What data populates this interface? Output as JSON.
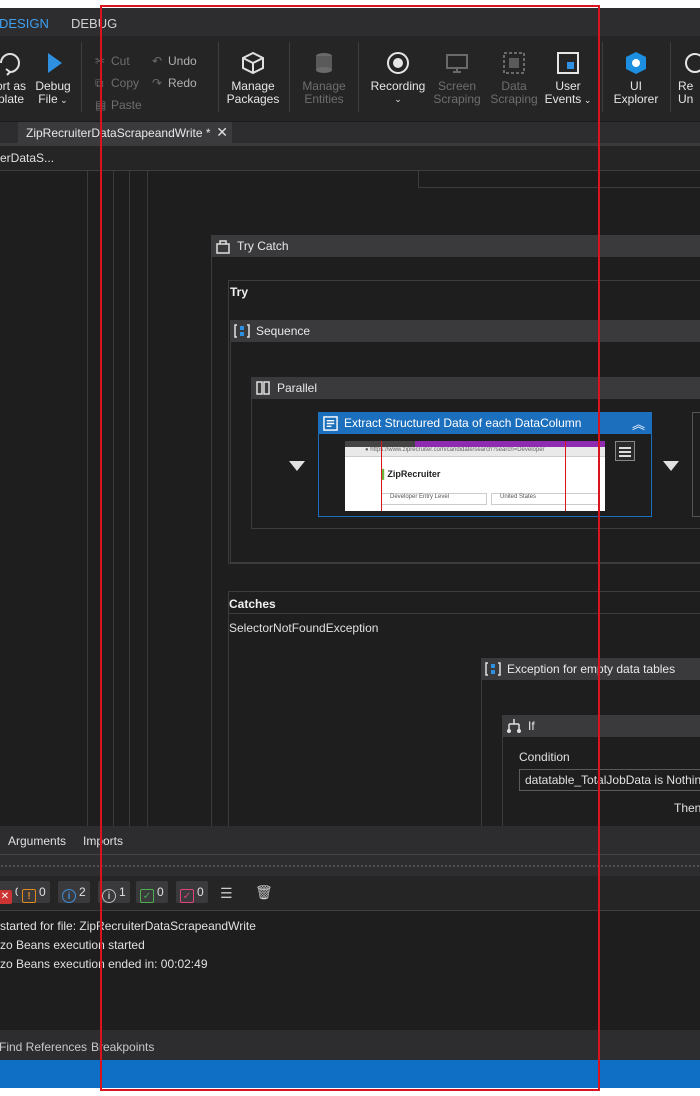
{
  "tabs": {
    "design": "DESIGN",
    "debug": "DEBUG"
  },
  "ribbon": {
    "export_template": [
      "ort as",
      "plate"
    ],
    "debug_file": [
      "Debug",
      "File"
    ],
    "cut": "Cut",
    "copy": "Copy",
    "paste": "Paste",
    "undo": "Undo",
    "redo": "Redo",
    "manage_packages": [
      "Manage",
      "Packages"
    ],
    "manage_entities": [
      "Manage",
      "Entities"
    ],
    "recording": "Recording",
    "screen_scraping": [
      "Screen",
      "Scraping"
    ],
    "data_scraping": [
      "Data",
      "Scraping"
    ],
    "user_events": [
      "User",
      "Events"
    ],
    "ui_explorer": [
      "UI",
      "Explorer"
    ],
    "remove_unused": [
      "Re",
      "Un"
    ]
  },
  "document": {
    "tab_title": "ZipRecruiterDataScrapeandWrite *",
    "breadcrumb": "erDataS..."
  },
  "workflow": {
    "try_catch": "Try Catch",
    "try_label": "Try",
    "sequence": "Sequence",
    "parallel": "Parallel",
    "extract_activity": "Extract Structured Data of each DataColumn",
    "thumb_site": "ZipRecruiter",
    "thumb_search": "Developer Entry Level",
    "thumb_location": "United States",
    "catches_label": "Catches",
    "exception_type": "SelectorNotFoundException",
    "exception_seq": "Exception for empty data tables",
    "if_label": "If",
    "condition_label": "Condition",
    "condition_value": "datatable_TotalJobData is Nothing",
    "then_label": "Then"
  },
  "panes": {
    "arguments": "Arguments",
    "imports": "Imports"
  },
  "output_filters": {
    "errors": "0",
    "warnings": "0",
    "info": "2",
    "trace": "1",
    "success": "0",
    "failed": "0"
  },
  "output_lines": [
    "started for file: ZipRecruiterDataScrapeandWrite",
    "zo Beans execution started",
    "zo Beans execution ended in: 00:02:49"
  ],
  "bottom_tabs": {
    "find_references": "Find References",
    "breakpoints": "Breakpoints"
  },
  "colors": {
    "accent": "#1c6fbd",
    "status_bar": "#0e6fc5",
    "annotation": "#d9141f"
  }
}
